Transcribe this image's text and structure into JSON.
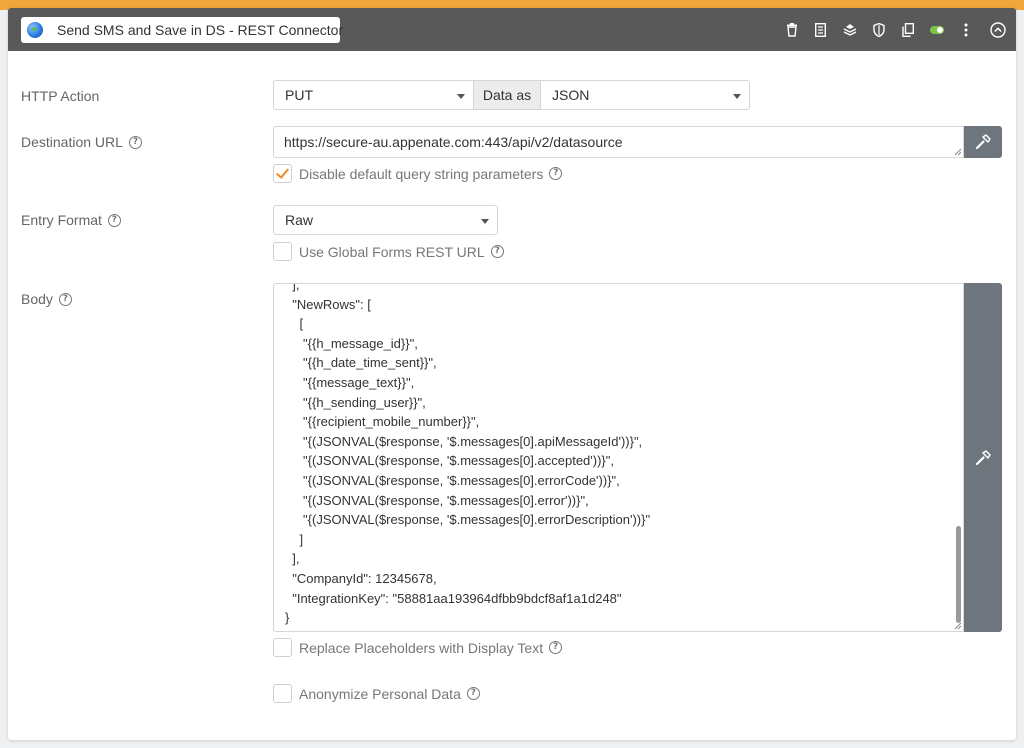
{
  "header": {
    "title": "Send SMS and Save in DS - REST Connector",
    "icons": [
      "globe-icon",
      "trash-icon",
      "document-icon",
      "stack-icon",
      "shield-icon",
      "copy-icon",
      "toggle-icon",
      "more-icon",
      "collapse-icon"
    ]
  },
  "http_action": {
    "label": "HTTP Action",
    "method": "PUT",
    "data_as_label": "Data as",
    "data_format": "JSON"
  },
  "destination_url": {
    "label": "Destination URL",
    "value": "https://secure-au.appenate.com:443/api/v2/datasource",
    "disable_query_label": "Disable default query string parameters",
    "disable_query_checked": true
  },
  "entry_format": {
    "label": "Entry Format",
    "value": "Raw",
    "global_rest_label": "Use Global Forms REST URL",
    "global_rest_checked": false
  },
  "body": {
    "label": "Body",
    "lines": [
      "  ],",
      "  \"NewRows\": [",
      "    [",
      "     \"{{h_message_id}}\",",
      "     \"{{h_date_time_sent}}\",",
      "     \"{{message_text}}\",",
      "     \"{{h_sending_user}}\",",
      "     \"{{recipient_mobile_number}}\",",
      "     \"{(JSONVAL($response, '$.messages[0].apiMessageId'))}\",",
      "     \"{(JSONVAL($response, '$.messages[0].accepted'))}\",",
      "     \"{(JSONVAL($response, '$.messages[0].errorCode'))}\",",
      "     \"{(JSONVAL($response, '$.messages[0].error'))}\",",
      "     \"{(JSONVAL($response, '$.messages[0].errorDescription'))}\"",
      "    ]",
      "  ],",
      "  \"CompanyId\": 12345678,",
      "  \"IntegrationKey\": \"58881aa193964dfbb9bdcf8af1a1d248\"",
      "}"
    ],
    "replace_label": "Replace Placeholders with Display Text",
    "replace_checked": false,
    "anonymize_label": "Anonymize Personal Data",
    "anonymize_checked": false
  },
  "colors": {
    "accent": "#f2a53a",
    "header_bg": "#595959",
    "button_bg": "#6e757d",
    "check": "#f08a24"
  }
}
